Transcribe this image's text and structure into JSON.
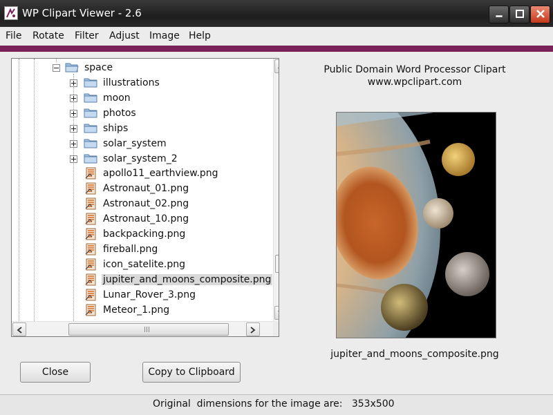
{
  "window": {
    "title": "WP Clipart Viewer - 2.6"
  },
  "menu": [
    "File",
    "Rotate",
    "Filter",
    "Adjust",
    "Image",
    "Help"
  ],
  "tree": {
    "root": {
      "label": "space",
      "expanded": true
    },
    "folders": [
      "illustrations",
      "moon",
      "photos",
      "ships",
      "solar_system",
      "solar_system_2"
    ],
    "files": [
      "apollo11_earthview.png",
      "Astronaut_01.png",
      "Astronaut_02.png",
      "Astronaut_10.png",
      "backpacking.png",
      "fireball.png",
      "icon_satelite.png",
      "jupiter_and_moons_composite.png",
      "Lunar_Rover_3.png",
      "Meteor_1.png"
    ],
    "selected_file": "jupiter_and_moons_composite.png"
  },
  "preview": {
    "header_line1": "Public Domain Word Processor Clipart",
    "header_line2": "www.wpclipart.com",
    "caption": "jupiter_and_moons_composite.png"
  },
  "buttons": {
    "close": "Close",
    "copy": "Copy to Clipboard"
  },
  "status": {
    "text": "Original  dimensions for the image are:   353x500"
  },
  "colors": {
    "accent_bar": "#7a2258",
    "titlebar": "#262626",
    "close_button": "#d9532f",
    "folder": "#8fb3d9",
    "selection": "#d9d9d9"
  },
  "icons": {
    "folder": "folder-icon",
    "file": "image-file-icon"
  }
}
